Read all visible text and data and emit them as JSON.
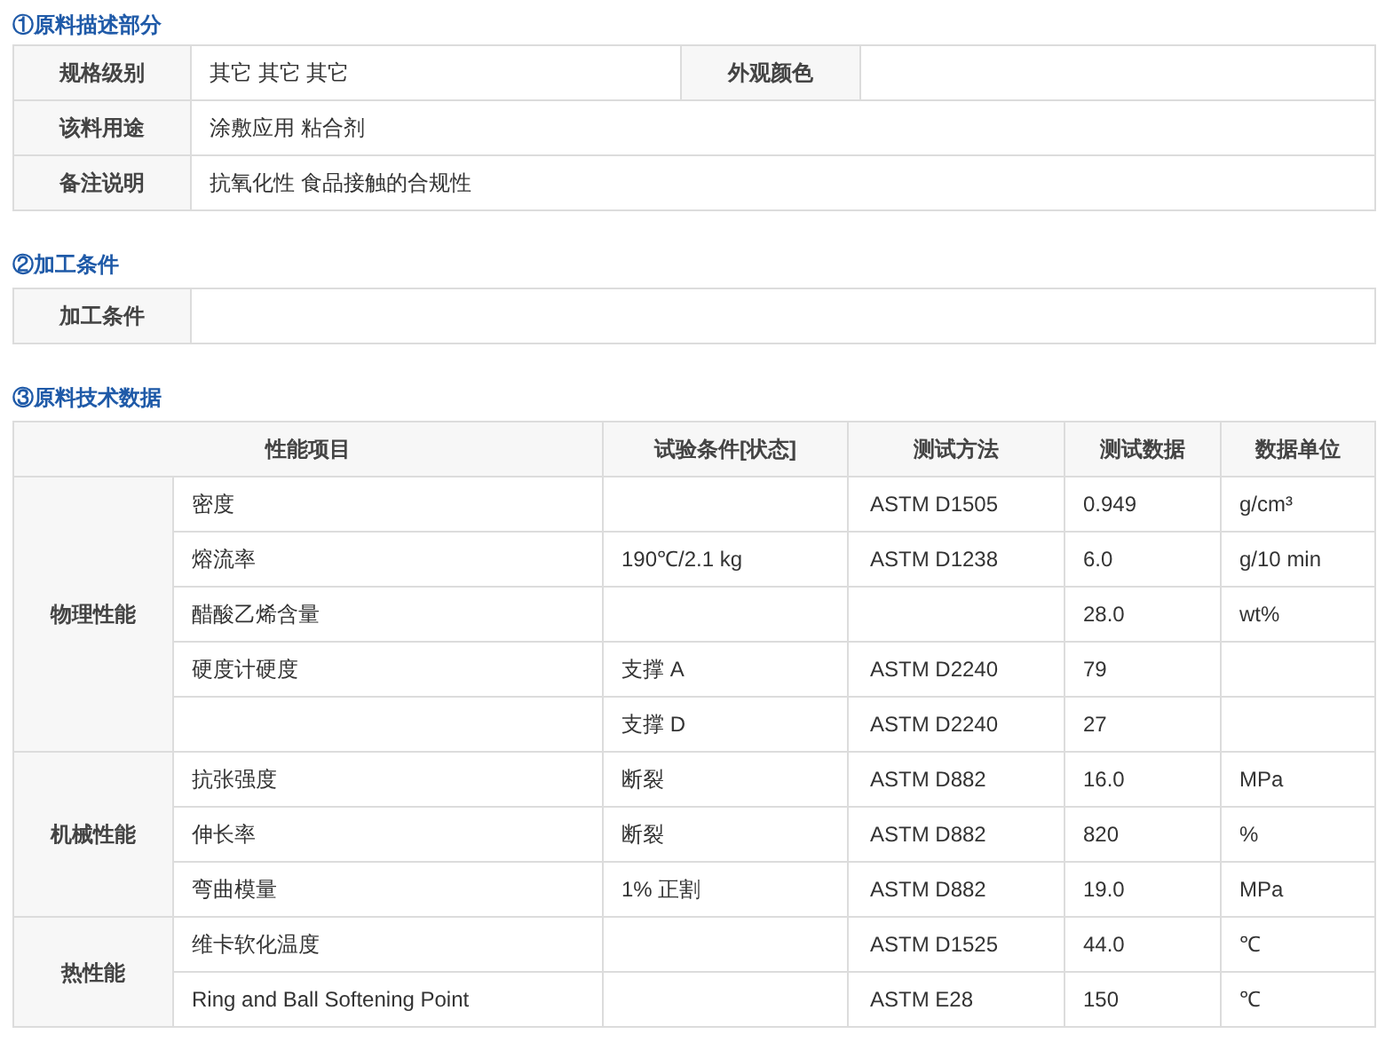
{
  "description_section": {
    "title": "①原料描述部分",
    "rows": [
      {
        "cells": [
          {
            "label": "规格级别",
            "value": "其它 其它 其它"
          },
          {
            "label": "外观颜色"
          }
        ]
      },
      {
        "cells": [
          {
            "label": "该料用途",
            "value": "涂敷应用 粘合剂"
          }
        ]
      },
      {
        "cells": [
          {
            "label": "备注说明",
            "value": "抗氧化性 食品接触的合规性"
          }
        ]
      }
    ]
  },
  "processing_section": {
    "title": "②加工条件",
    "rows": [
      {
        "cells": [
          {
            "label": "加工条件"
          }
        ]
      }
    ]
  },
  "technical_section": {
    "title": "③原料技术数据",
    "columns": [
      "性能项目",
      "试验条件[状态]",
      "测试方法",
      "测试数据",
      "数据单位"
    ],
    "groups": [
      {
        "name": "物理性能",
        "rows": [
          {
            "item": "密度",
            "method": "ASTM D1505",
            "value": "0.949",
            "unit": "g/cm³"
          },
          {
            "item": "熔流率",
            "condition": "190℃/2.1 kg",
            "method": "ASTM D1238",
            "value": "6.0",
            "unit": "g/10 min"
          },
          {
            "item": "醋酸乙烯含量",
            "value": "28.0",
            "unit": "wt%"
          },
          {
            "item": "硬度计硬度",
            "condition": "支撑 A",
            "method": "ASTM D2240",
            "value": "79"
          },
          {
            "condition": "支撑 D",
            "method": "ASTM D2240",
            "value": "27"
          }
        ]
      },
      {
        "name": "机械性能",
        "rows": [
          {
            "item": "抗张强度",
            "condition": "断裂",
            "method": "ASTM D882",
            "value": "16.0",
            "unit": "MPa"
          },
          {
            "item": "伸长率",
            "condition": "断裂",
            "method": "ASTM D882",
            "value": "820",
            "unit": "%"
          },
          {
            "item": "弯曲模量",
            "condition": "1% 正割",
            "method": "ASTM D882",
            "value": "19.0",
            "unit": "MPa"
          }
        ]
      },
      {
        "name": "热性能",
        "rows": [
          {
            "item": "维卡软化温度",
            "method": "ASTM D1525",
            "value": "44.0",
            "unit": "℃"
          },
          {
            "item": "Ring and Ball Softening Point",
            "method": "ASTM E28",
            "value": "150",
            "unit": "℃"
          }
        ]
      }
    ]
  }
}
